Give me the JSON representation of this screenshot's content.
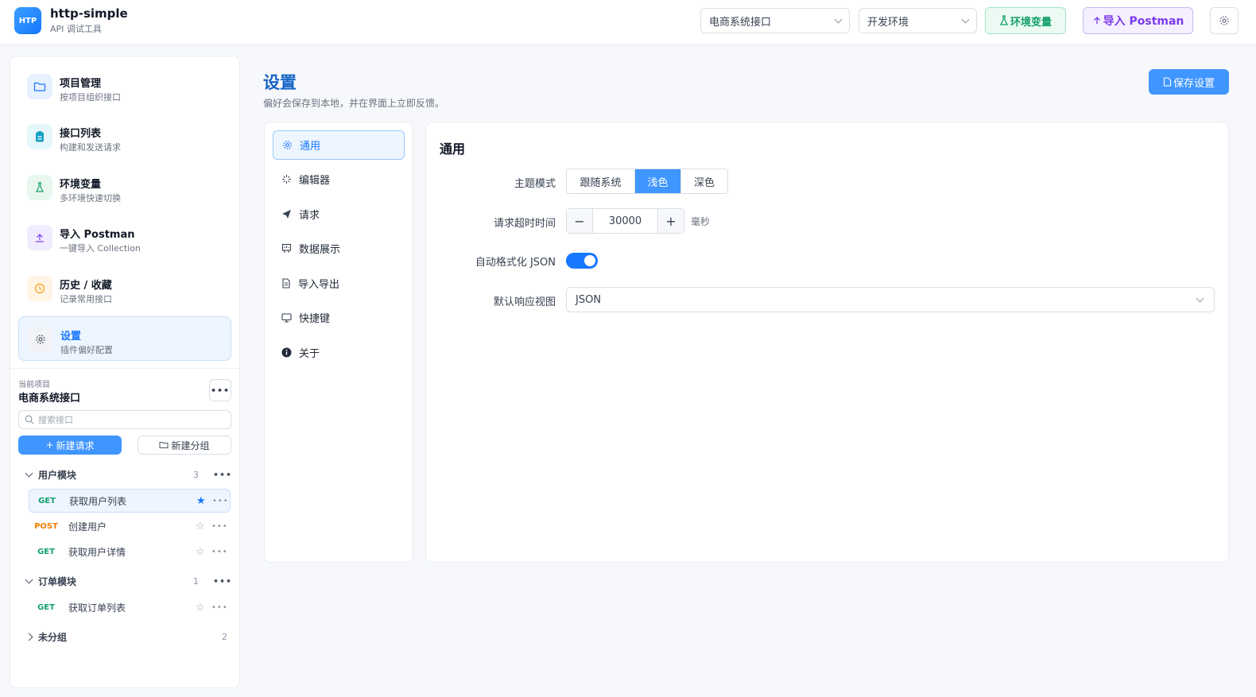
{
  "app": {
    "logo_text": "HTP",
    "title": "http-simple",
    "subtitle": "API 调试工具"
  },
  "topbar": {
    "project_select": "电商系统接口",
    "env_select": "开发环境",
    "env_button": "环境变量",
    "import_button": "导入 Postman"
  },
  "sidebar": {
    "nav": [
      {
        "label": "项目管理",
        "desc": "按项目组织接口",
        "icon": "folder-icon",
        "color": "#e8f1ff"
      },
      {
        "label": "接口列表",
        "desc": "构建和发送请求",
        "icon": "clipboard-icon",
        "color": "#e6f7fb"
      },
      {
        "label": "环境变量",
        "desc": "多环境快速切换",
        "icon": "flask-icon",
        "color": "#e8f8ef"
      },
      {
        "label": "导入 Postman",
        "desc": "一键导入 Collection",
        "icon": "upload-icon",
        "color": "#f1ecff"
      },
      {
        "label": "历史 / 收藏",
        "desc": "记录常用接口",
        "icon": "clock-icon",
        "color": "#fff4e5"
      },
      {
        "label": "设置",
        "desc": "插件偏好配置",
        "icon": "gear-icon",
        "color": "#f1f3f6"
      }
    ],
    "current_project_label": "当前项目",
    "current_project_name": "电商系统接口",
    "search_placeholder": "搜索接口",
    "new_request": "新建请求",
    "new_group": "新建分组",
    "groups": [
      {
        "name": "用户模块",
        "count": "3",
        "expanded": true
      },
      {
        "name": "订单模块",
        "count": "1",
        "expanded": true
      },
      {
        "name": "未分组",
        "count": "2",
        "expanded": false
      }
    ],
    "requests": [
      {
        "method": "GET",
        "name": "获取用户列表",
        "starred": true
      },
      {
        "method": "POST",
        "name": "创建用户",
        "starred": false
      },
      {
        "method": "GET",
        "name": "获取用户详情",
        "starred": false
      },
      {
        "method": "GET",
        "name": "获取订单列表",
        "starred": false
      }
    ]
  },
  "main": {
    "title": "设置",
    "subtitle": "偏好会保存到本地，并在界面上立即反馈。",
    "save_button": "保存设置",
    "settings_nav": [
      {
        "label": "通用",
        "icon": "gear-icon"
      },
      {
        "label": "编辑器",
        "icon": "sparkle-icon"
      },
      {
        "label": "请求",
        "icon": "send-icon"
      },
      {
        "label": "数据展示",
        "icon": "chart-icon"
      },
      {
        "label": "导入导出",
        "icon": "document-icon"
      },
      {
        "label": "快捷键",
        "icon": "monitor-icon"
      },
      {
        "label": "关于",
        "icon": "info-icon"
      }
    ],
    "panel": {
      "title": "通用",
      "theme_label": "主题模式",
      "theme_options": [
        "跟随系统",
        "浅色",
        "深色"
      ],
      "theme_selected": "浅色",
      "timeout_label": "请求超时时间",
      "timeout_value": "30000",
      "timeout_unit": "毫秒",
      "autoformat_label": "自动格式化 JSON",
      "autoformat_on": true,
      "default_view_label": "默认响应视图",
      "default_view_value": "JSON"
    }
  }
}
